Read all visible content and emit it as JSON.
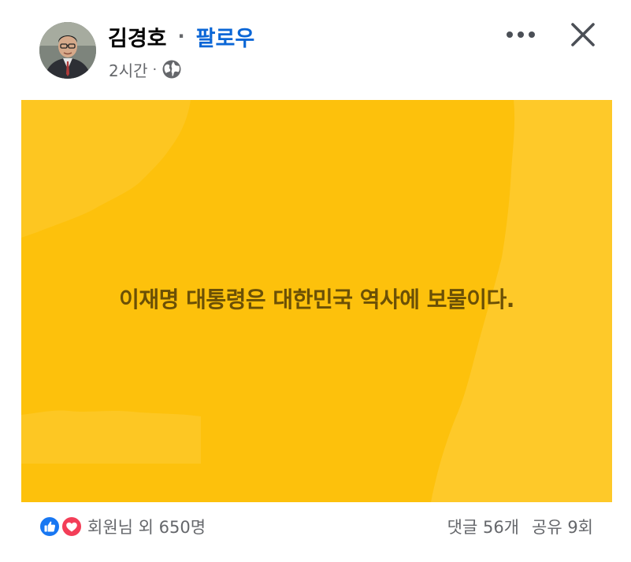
{
  "post": {
    "author_name": "김경호",
    "separator": "·",
    "follow_label": "팔로우",
    "time": "2시간",
    "meta_separator": "·",
    "audience_icon": "globe-icon",
    "more_icon": "more-options-icon",
    "close_icon": "close-icon"
  },
  "image": {
    "text": "이재명 대통령은 대한민국 역사에 보물이다.",
    "background_color": "#fdc10c",
    "text_color": "#6b5006"
  },
  "footer": {
    "reactions": [
      "like-reaction-icon",
      "love-reaction-icon"
    ],
    "reaction_summary": "회원님 외 650명",
    "comments": "댓글 56개",
    "shares": "공유 9회"
  },
  "colors": {
    "follow_blue": "#0a66d6",
    "secondary_text": "#65676b",
    "like_blue": "#1877f2",
    "love_red": "#f33e58"
  }
}
